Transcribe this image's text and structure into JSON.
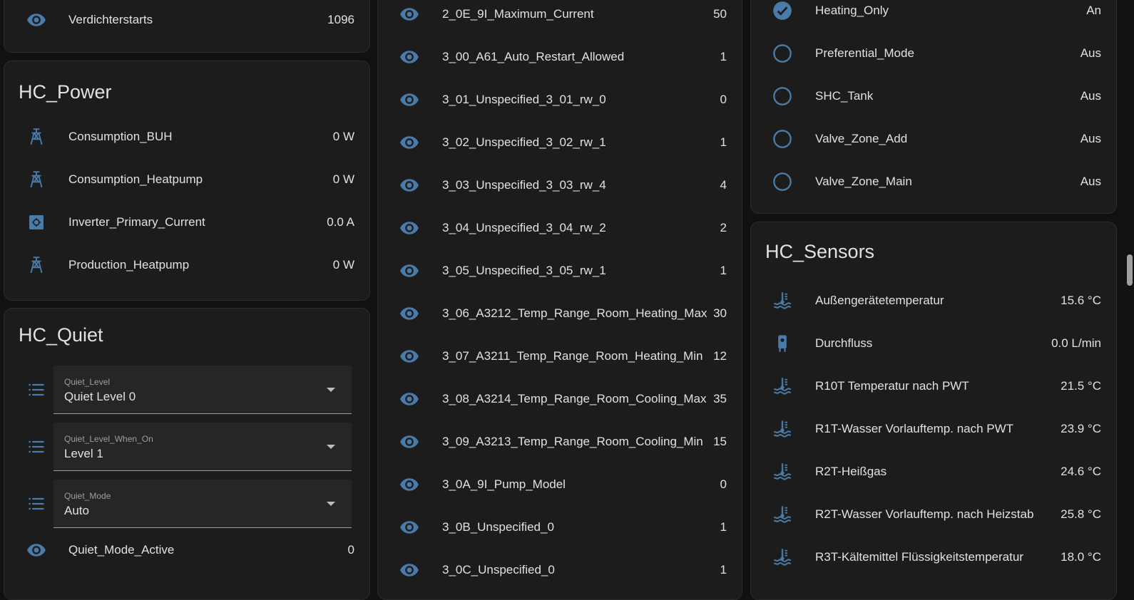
{
  "colors": {
    "accent": "#4a7aa8",
    "card": "#1c1c1c",
    "background": "#111111",
    "text": "#e1e1e1"
  },
  "card_top_left": {
    "rows": [
      {
        "icon": "eye-icon",
        "label": "Verdichterstarts",
        "value": "1096"
      }
    ]
  },
  "hc_power": {
    "title": "HC_Power",
    "rows": [
      {
        "icon": "transmission-tower-icon",
        "label": "Consumption_BUH",
        "value": "0 W"
      },
      {
        "icon": "transmission-tower-icon",
        "label": "Consumption_Heatpump",
        "value": "0 W"
      },
      {
        "icon": "current-ac-icon",
        "label": "Inverter_Primary_Current",
        "value": "0.0 A"
      },
      {
        "icon": "transmission-tower-icon",
        "label": "Production_Heatpump",
        "value": "0 W"
      }
    ]
  },
  "hc_quiet": {
    "title": "HC_Quiet",
    "selects": [
      {
        "icon": "format-list-bulleted-icon",
        "label": "Quiet_Level",
        "value": "Quiet Level 0"
      },
      {
        "icon": "format-list-bulleted-icon",
        "label": "Quiet_Level_When_On",
        "value": "Level 1"
      },
      {
        "icon": "format-list-bulleted-icon",
        "label": "Quiet_Mode",
        "value": "Auto"
      }
    ],
    "rows": [
      {
        "icon": "eye-icon",
        "label": "Quiet_Mode_Active",
        "value": "0"
      }
    ]
  },
  "middle_card": {
    "rows": [
      {
        "icon": "eye-icon",
        "label": "2_0E_9I_Maximum_Current",
        "value": "50"
      },
      {
        "icon": "eye-icon",
        "label": "3_00_A61_Auto_Restart_Allowed",
        "value": "1"
      },
      {
        "icon": "eye-icon",
        "label": "3_01_Unspecified_3_01_rw_0",
        "value": "0"
      },
      {
        "icon": "eye-icon",
        "label": "3_02_Unspecified_3_02_rw_1",
        "value": "1"
      },
      {
        "icon": "eye-icon",
        "label": "3_03_Unspecified_3_03_rw_4",
        "value": "4"
      },
      {
        "icon": "eye-icon",
        "label": "3_04_Unspecified_3_04_rw_2",
        "value": "2"
      },
      {
        "icon": "eye-icon",
        "label": "3_05_Unspecified_3_05_rw_1",
        "value": "1"
      },
      {
        "icon": "eye-icon",
        "label": "3_06_A3212_Temp_Range_Room_Heating_Max",
        "value": "30"
      },
      {
        "icon": "eye-icon",
        "label": "3_07_A3211_Temp_Range_Room_Heating_Min",
        "value": "12"
      },
      {
        "icon": "eye-icon",
        "label": "3_08_A3214_Temp_Range_Room_Cooling_Max",
        "value": "35"
      },
      {
        "icon": "eye-icon",
        "label": "3_09_A3213_Temp_Range_Room_Cooling_Min",
        "value": "15"
      },
      {
        "icon": "eye-icon",
        "label": "3_0A_9I_Pump_Model",
        "value": "0"
      },
      {
        "icon": "eye-icon",
        "label": "3_0B_Unspecified_0",
        "value": "1"
      },
      {
        "icon": "eye-icon",
        "label": "3_0C_Unspecified_0",
        "value": "1"
      }
    ]
  },
  "right_top_card": {
    "rows": [
      {
        "icon": "checkbox-marked-circle-icon",
        "label": "Heating_Only",
        "value": "An"
      },
      {
        "icon": "checkbox-blank-circle-outline-icon",
        "label": "Preferential_Mode",
        "value": "Aus"
      },
      {
        "icon": "checkbox-blank-circle-outline-icon",
        "label": "SHC_Tank",
        "value": "Aus"
      },
      {
        "icon": "checkbox-blank-circle-outline-icon",
        "label": "Valve_Zone_Add",
        "value": "Aus"
      },
      {
        "icon": "checkbox-blank-circle-outline-icon",
        "label": "Valve_Zone_Main",
        "value": "Aus"
      }
    ]
  },
  "hc_sensors": {
    "title": "HC_Sensors",
    "rows": [
      {
        "icon": "thermometer-water-icon",
        "label": "Außengerätetemperatur",
        "value": "15.6 °C"
      },
      {
        "icon": "water-pump-icon",
        "label": "Durchfluss",
        "value": "0.0 L/min"
      },
      {
        "icon": "thermometer-water-icon",
        "label": "R10T Temperatur nach PWT",
        "value": "21.5 °C"
      },
      {
        "icon": "thermometer-water-icon",
        "label": "R1T-Wasser Vorlauftemp. nach PWT",
        "value": "23.9 °C"
      },
      {
        "icon": "thermometer-water-icon",
        "label": "R2T-Heißgas",
        "value": "24.6 °C"
      },
      {
        "icon": "thermometer-water-icon",
        "label": "R2T-Wasser Vorlauftemp. nach Heizstab",
        "value": "25.8 °C"
      },
      {
        "icon": "thermometer-water-icon",
        "label": "R3T-Kältemittel Flüssigkeitstemperatur",
        "value": "18.0 °C"
      }
    ]
  }
}
